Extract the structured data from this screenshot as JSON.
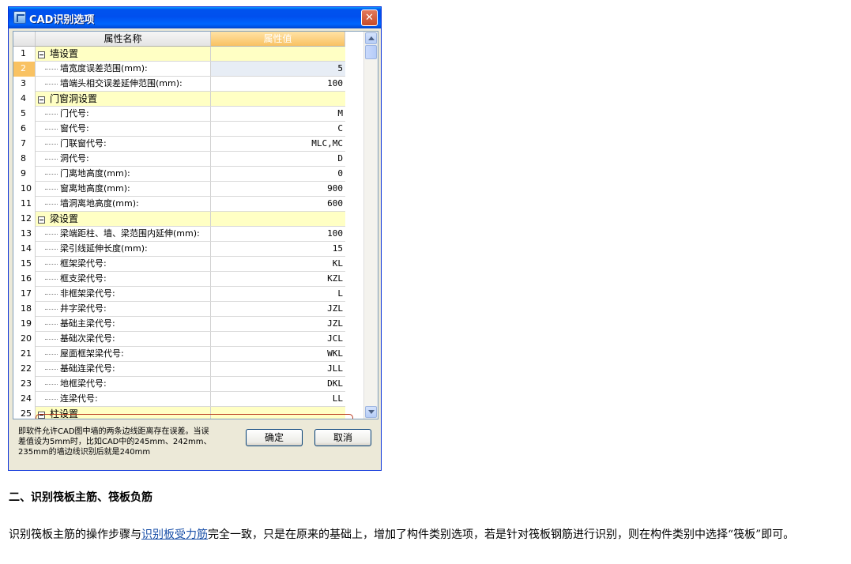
{
  "dialog": {
    "title": "CAD识别选项",
    "close_glyph": "✕",
    "columns": {
      "name": "属性名称",
      "value": "属性值"
    },
    "rows": [
      {
        "num": "1",
        "label": "墙设置",
        "value": "",
        "type": "group"
      },
      {
        "num": "2",
        "label": "墙宽度误差范围(mm):",
        "value": "5",
        "type": "item",
        "selected": true
      },
      {
        "num": "3",
        "label": "墙端头相交误差延伸范围(mm):",
        "value": "100",
        "type": "item"
      },
      {
        "num": "4",
        "label": "门窗洞设置",
        "value": "",
        "type": "group"
      },
      {
        "num": "5",
        "label": "门代号:",
        "value": "M",
        "type": "item"
      },
      {
        "num": "6",
        "label": "窗代号:",
        "value": "C",
        "type": "item"
      },
      {
        "num": "7",
        "label": "门联窗代号:",
        "value": "MLC,MC",
        "type": "item"
      },
      {
        "num": "8",
        "label": "洞代号:",
        "value": "D",
        "type": "item"
      },
      {
        "num": "9",
        "label": "门离地高度(mm):",
        "value": "0",
        "type": "item"
      },
      {
        "num": "10",
        "label": "窗离地高度(mm):",
        "value": "900",
        "type": "item"
      },
      {
        "num": "11",
        "label": "墙洞离地高度(mm):",
        "value": "600",
        "type": "item"
      },
      {
        "num": "12",
        "label": "梁设置",
        "value": "",
        "type": "group"
      },
      {
        "num": "13",
        "label": "梁端距柱、墙、梁范围内延伸(mm):",
        "value": "100",
        "type": "item"
      },
      {
        "num": "14",
        "label": "梁引线延伸长度(mm):",
        "value": "15",
        "type": "item"
      },
      {
        "num": "15",
        "label": "框架梁代号:",
        "value": "KL",
        "type": "item"
      },
      {
        "num": "16",
        "label": "框支梁代号:",
        "value": "KZL",
        "type": "item"
      },
      {
        "num": "17",
        "label": "非框架梁代号:",
        "value": "L",
        "type": "item"
      },
      {
        "num": "18",
        "label": "井字梁代号:",
        "value": "JZL",
        "type": "item"
      },
      {
        "num": "19",
        "label": "基础主梁代号:",
        "value": "JZL",
        "type": "item"
      },
      {
        "num": "20",
        "label": "基础次梁代号:",
        "value": "JCL",
        "type": "item"
      },
      {
        "num": "21",
        "label": "屋面框架梁代号:",
        "value": "WKL",
        "type": "item"
      },
      {
        "num": "22",
        "label": "基础连梁代号:",
        "value": "JLL",
        "type": "item"
      },
      {
        "num": "23",
        "label": "地框梁代号:",
        "value": "DKL",
        "type": "item"
      },
      {
        "num": "24",
        "label": "连梁代号:",
        "value": "LL",
        "type": "item",
        "highlighted": true
      },
      {
        "num": "25",
        "label": "柱设置",
        "value": "",
        "type": "group"
      }
    ],
    "description": "即软件允许CAD图中墙的两条边线距离存在误差。当误差值设为5mm时，比如CAD中的245mm、242mm、235mm的墙边线识别后就是240mm",
    "ok_label": "确定",
    "cancel_label": "取消"
  },
  "article": {
    "heading": "二、识别筏板主筋、筏板负筋",
    "para_before": "识别筏板主筋的操作步骤与",
    "para_link": "识别板受力筋",
    "para_after": "完全一致，只是在原来的基础上，增加了构件类别选项，若是针对筏板钢筋进行识别，则在构件类别中选择“筏板”即可。"
  },
  "colors": {
    "title_bar": "#0054e3",
    "group_row": "#ffffc4",
    "value_header": "#f9c262",
    "highlight": "#b8361a",
    "link": "#1a50a8"
  }
}
